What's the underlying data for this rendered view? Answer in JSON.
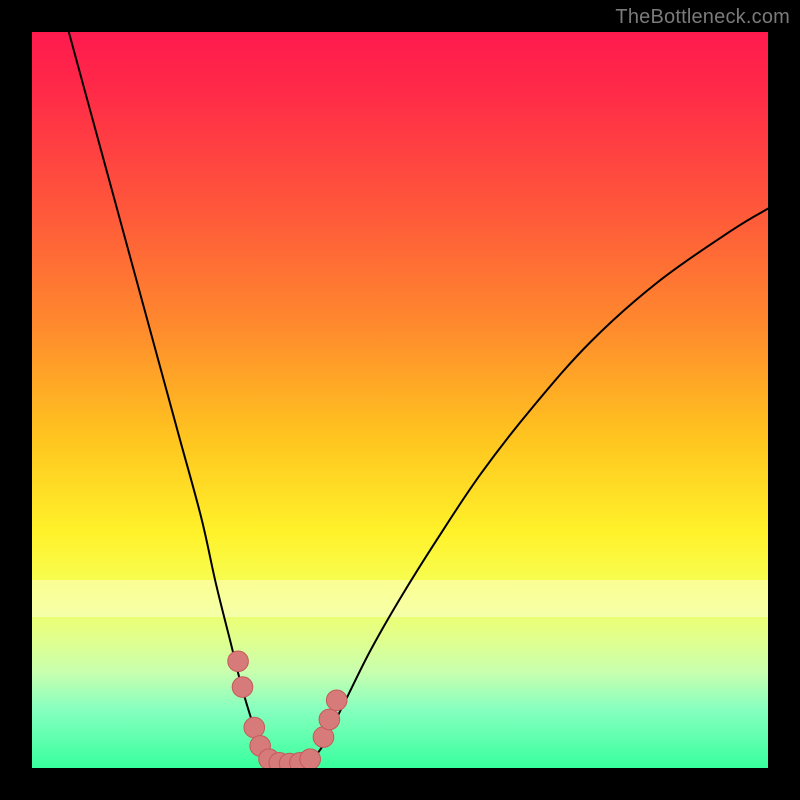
{
  "watermark": "TheBottleneck.com",
  "colors": {
    "frame": "#000000",
    "curve": "#000000",
    "marker_fill": "#d77a7a",
    "marker_stroke": "#c45a5a"
  },
  "chart_data": {
    "type": "line",
    "title": "",
    "xlabel": "",
    "ylabel": "",
    "xlim": [
      0,
      100
    ],
    "ylim": [
      0,
      100
    ],
    "grid": false,
    "note": "Values are estimated from pixel positions since the chart has no axis tick labels. y=0 at bottom (green), y=100 at top (red). x=0 left, x=100 right.",
    "series": [
      {
        "name": "left-branch",
        "x": [
          5,
          8,
          11,
          14,
          17,
          20,
          23,
          25,
          27,
          28.5,
          30,
          31,
          32
        ],
        "y": [
          100,
          89,
          78,
          67,
          56,
          45,
          34,
          25,
          17,
          11,
          6,
          3,
          1
        ]
      },
      {
        "name": "right-branch",
        "x": [
          38,
          39.5,
          41,
          43,
          46,
          50,
          55,
          61,
          68,
          76,
          85,
          95,
          100
        ],
        "y": [
          1,
          3,
          6,
          10,
          16,
          23,
          31,
          40,
          49,
          58,
          66,
          73,
          76
        ]
      },
      {
        "name": "valley-floor",
        "x": [
          32,
          33.5,
          35,
          36.5,
          38
        ],
        "y": [
          1,
          0.5,
          0.4,
          0.5,
          1
        ]
      }
    ],
    "markers": [
      {
        "x": 28.0,
        "y": 14.5,
        "r": 1.4
      },
      {
        "x": 28.6,
        "y": 11.0,
        "r": 1.4
      },
      {
        "x": 30.2,
        "y": 5.5,
        "r": 1.4
      },
      {
        "x": 31.0,
        "y": 3.0,
        "r": 1.4
      },
      {
        "x": 32.2,
        "y": 1.2,
        "r": 1.4
      },
      {
        "x": 33.6,
        "y": 0.7,
        "r": 1.4
      },
      {
        "x": 35.0,
        "y": 0.6,
        "r": 1.4
      },
      {
        "x": 36.4,
        "y": 0.7,
        "r": 1.4
      },
      {
        "x": 37.8,
        "y": 1.2,
        "r": 1.4
      },
      {
        "x": 39.6,
        "y": 4.2,
        "r": 1.4
      },
      {
        "x": 40.4,
        "y": 6.6,
        "r": 1.4
      },
      {
        "x": 41.4,
        "y": 9.2,
        "r": 1.4
      }
    ]
  }
}
